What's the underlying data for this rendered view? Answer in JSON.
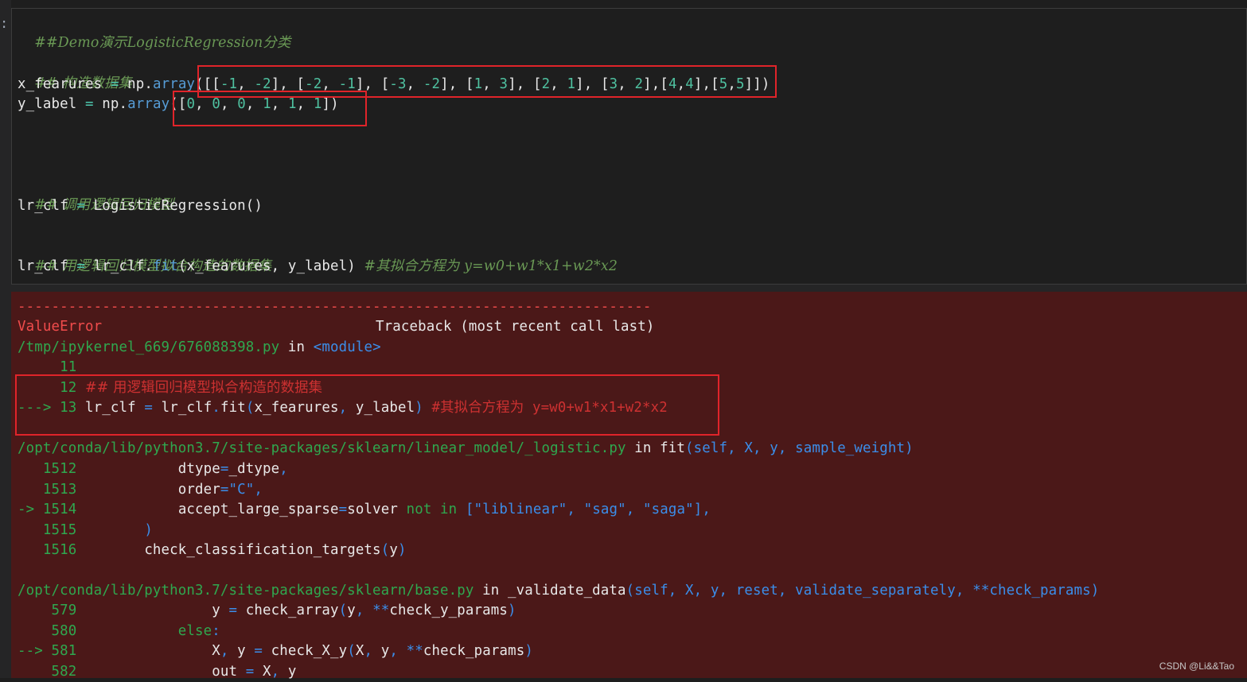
{
  "prompt_mark": ":",
  "code": {
    "title_comment": "##Demo演示LogisticRegression分类",
    "comment_build": "## 构造数据集",
    "x_var": "x_fearures",
    "eq": "=",
    "np_prefix": "np.",
    "array_fn": "array",
    "x_open": "([[",
    "x_data": [
      "-1",
      "-2",
      "-2",
      "-1",
      "-3",
      "-2",
      "1",
      "3",
      "2",
      "1",
      "3",
      "2",
      "4",
      "4",
      "5",
      "5"
    ],
    "y_var": "y_label",
    "y_open": "([",
    "y_data": [
      "0",
      "0",
      "0",
      "1",
      "1",
      "1"
    ],
    "comment_model": "## 调用逻辑回归模型",
    "clf_var": "lr_clf",
    "clf_ctor": "LogisticRegression()",
    "comment_fit": "## 用逻辑回归模型拟合构造的数据集",
    "fit_lhs": "lr_clf",
    "fit_obj": "lr_clf.",
    "fit_fn": "fit",
    "fit_args": "(x_fearures, y_label)",
    "fit_comment": "#其拟合方程为 y=w0+w1*x1+w2*x2"
  },
  "output": {
    "dashes": "---------------------------------------------------------------------------",
    "error_type": "ValueError",
    "traceback_title": "Traceback (most recent call last)",
    "frame1": {
      "file": "/tmp/ipykernel_669/676088398.py",
      "in_word": "in",
      "where": "<module>",
      "lines": [
        {
          "no": "     11",
          "arrow": "",
          "kind": "blank",
          "text": ""
        },
        {
          "no": "     12",
          "arrow": "",
          "kind": "comment",
          "text": "## 用逻辑回归模型拟合构造的数据集"
        },
        {
          "no": " 13",
          "arrow": "--->",
          "kind": "call",
          "text": ""
        }
      ],
      "call_lhs": "lr_clf",
      "call_eq": "=",
      "call_obj": "lr_clf",
      "call_dot": ".",
      "call_fn": "fit",
      "call_args_a": "x_fearures",
      "call_args_b": "y_label",
      "call_comment": "#其拟合方程为 y=w0+w1*x1+w2*x2"
    },
    "frame2": {
      "file": "/opt/conda/lib/python3.7/site-packages/sklearn/linear_model/_logistic.py",
      "in_word": "in",
      "func": "fit",
      "sig": "(self, X, y, sample_weight)",
      "lines": [
        {
          "no": "   1512",
          "arrow": "",
          "code": "            dtype=_dtype,"
        },
        {
          "no": "   1513",
          "arrow": "",
          "code": "            order=\"C\","
        },
        {
          "no": " 1514",
          "arrow": "->",
          "code": "            accept_large_sparse=solver not in [\"liblinear\", \"sag\", \"saga\"],"
        },
        {
          "no": "   1515",
          "arrow": "",
          "code": "        )"
        },
        {
          "no": "   1516",
          "arrow": "",
          "code": "        check_classification_targets(y)"
        }
      ]
    },
    "frame3": {
      "file": "/opt/conda/lib/python3.7/site-packages/sklearn/base.py",
      "in_word": "in",
      "func": "_validate_data",
      "sig": "(self, X, y, reset, validate_separately, **check_params)",
      "lines": [
        {
          "no": "    579",
          "arrow": "",
          "code": "                y = check_array(y, **check_y_params)"
        },
        {
          "no": "    580",
          "arrow": "",
          "code": "            else:"
        },
        {
          "no": " 581",
          "arrow": "-->",
          "code": "                X, y = check_X_y(X, y, **check_params)"
        },
        {
          "no": "    582",
          "arrow": "",
          "code": "                out = X, y"
        }
      ]
    }
  },
  "watermark": "CSDN @Li&&Tao"
}
